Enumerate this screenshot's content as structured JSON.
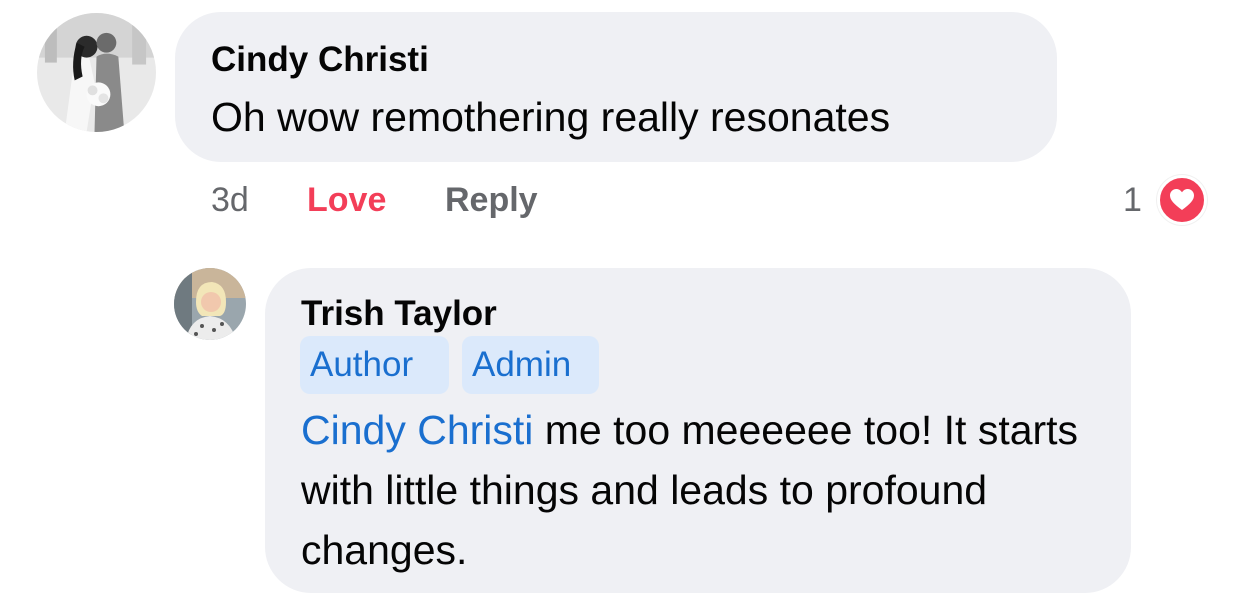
{
  "comment": {
    "author": "Cindy Christi",
    "text": "Oh wow remothering really resonates",
    "time": "3d",
    "love_label": "Love",
    "reply_label": "Reply",
    "reaction_count": "1",
    "reaction_icon": "heart-icon",
    "colors": {
      "bubble": "#eff0f4",
      "love": "#f33e58",
      "muted": "#65676b"
    }
  },
  "reply": {
    "author": "Trish Taylor",
    "badges": [
      "Author",
      "Admin"
    ],
    "mention": "Cindy Christi",
    "text": " me too meeeeee too! It starts with little things and leads to profound changes.",
    "colors": {
      "badge_bg": "#dbe9fb",
      "link": "#1a6fcf"
    }
  }
}
